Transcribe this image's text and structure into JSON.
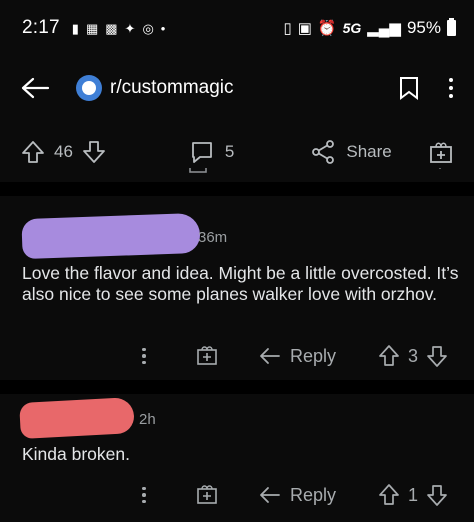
{
  "status_bar": {
    "time": "2:17",
    "network": "5G",
    "battery": "95%"
  },
  "header": {
    "subreddit": "r/custommagic"
  },
  "post_actions": {
    "upvotes": "46",
    "comments": "5",
    "share_label": "Share"
  },
  "comments": [
    {
      "time": "36m",
      "body": "Love the flavor and idea. Might be a little overcosted. It’s also nice to see some planes walker love with orzhov.",
      "reply_label": "Reply",
      "score": "3",
      "author_mask_color": "#a78bde"
    },
    {
      "time": "2h",
      "body": "Kinda broken.",
      "reply_label": "Reply",
      "score": "1",
      "author_mask_color": "#e8686a"
    }
  ]
}
